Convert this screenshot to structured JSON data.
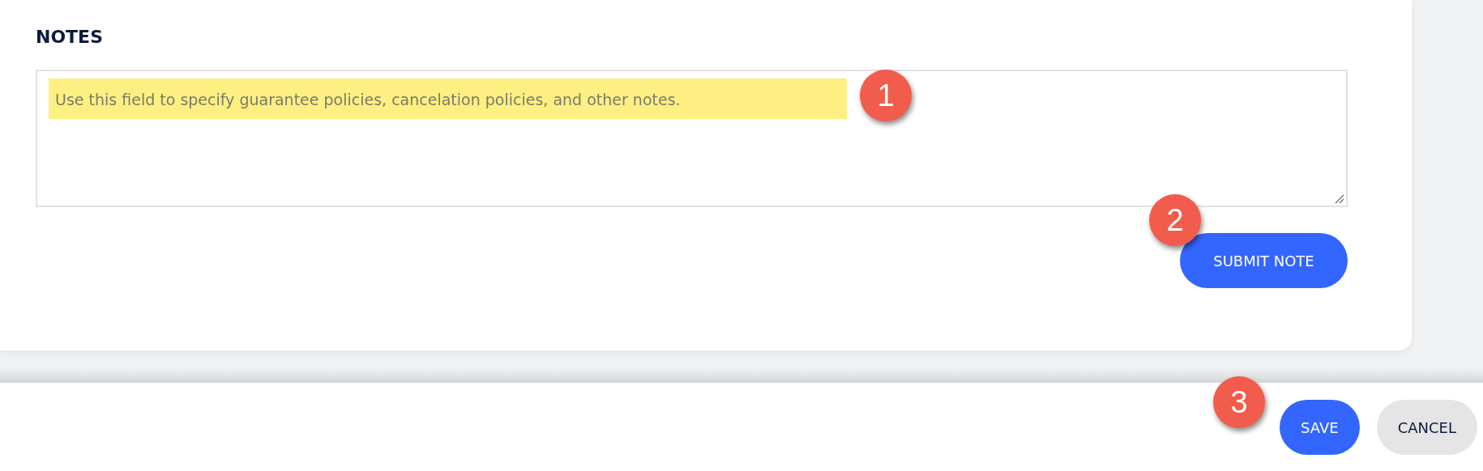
{
  "notes": {
    "heading": "NOTES",
    "placeholder": "Use this field to specify guarantee policies, cancelation policies, and other notes.",
    "submit_button": "SUBMIT NOTE"
  },
  "footer": {
    "buttons": [
      {
        "label": "SAVE",
        "kind": "primary"
      },
      {
        "label": "CANCEL",
        "kind": "secondary"
      }
    ]
  },
  "annotations": [
    {
      "label": "1"
    },
    {
      "label": "2"
    },
    {
      "label": "3"
    }
  ]
}
